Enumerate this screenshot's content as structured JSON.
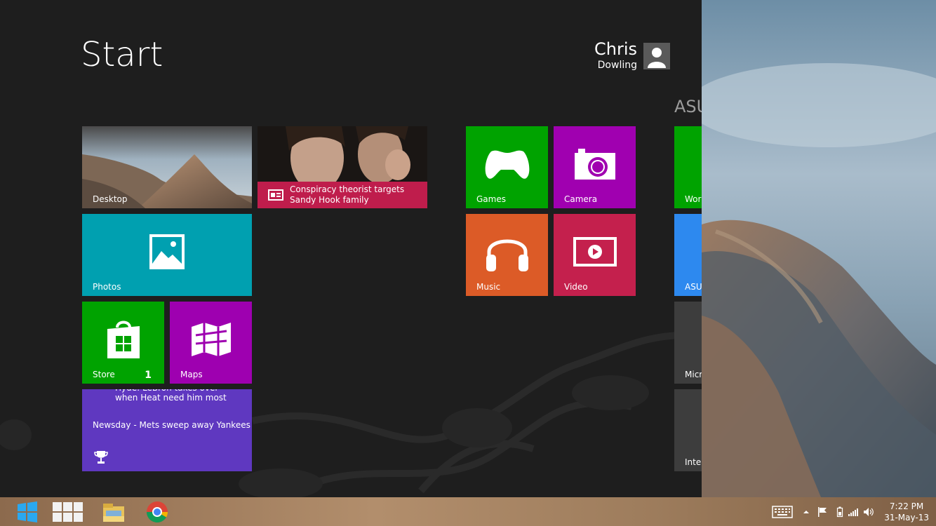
{
  "start": {
    "title": "Start",
    "user": {
      "first_name": "Chris",
      "last_name": "Dowling"
    },
    "group_title": "ASUS"
  },
  "tiles": {
    "desktop": {
      "label": "Desktop"
    },
    "news": {
      "headline": "Conspiracy theorist targets Sandy Hook family"
    },
    "photos": {
      "label": "Photos"
    },
    "store": {
      "label": "Store",
      "badge": "1"
    },
    "maps": {
      "label": "Maps"
    },
    "sport": {
      "headline_top": "Hyde: LeBron takes over when Heat need him most",
      "headline_bottom": "Newsday - Mets sweep away Yankees"
    },
    "games": {
      "label": "Games"
    },
    "camera": {
      "label": "Camera"
    },
    "music": {
      "label": "Music"
    },
    "video": {
      "label": "Video"
    },
    "asus_world": {
      "label": "World"
    },
    "asus_app": {
      "label": "ASUS"
    },
    "microsoft": {
      "label": "Micro"
    },
    "intel": {
      "label": "Intel"
    }
  },
  "colors": {
    "background": "#1e1e1e",
    "desktop_tile": "#6e8aa0",
    "news_bar": "#bf1d4c",
    "photos": "#00a0b0",
    "store": "#00a300",
    "maps": "#9e00b0",
    "sport": "#5f38c0",
    "games": "#00a300",
    "camera": "#a000b0",
    "music": "#dc5b27",
    "video": "#c4204d",
    "asus_world": "#00a300",
    "asus_app": "#2d89ef",
    "microsoft": "#3d3d3d",
    "intel": "#3d3d3d"
  },
  "taskbar": {
    "items": [
      "windows-start-icon",
      "apps-grid-icon",
      "file-explorer-icon",
      "chrome-icon"
    ],
    "clock": {
      "time": "7:22 PM",
      "date": "31-May-13"
    }
  }
}
